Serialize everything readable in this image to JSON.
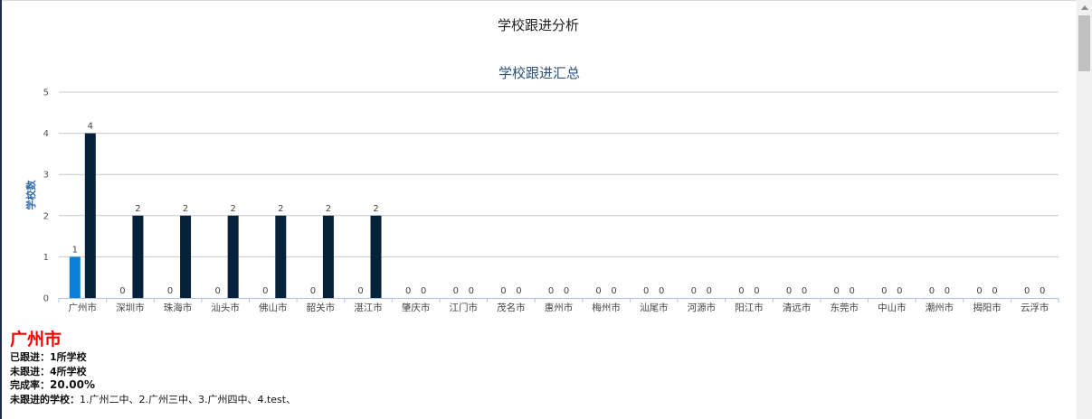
{
  "page": {
    "title": "学校跟进分析"
  },
  "chart_data": {
    "type": "bar",
    "title": "学校跟进汇总",
    "xlabel": "",
    "ylabel": "学校数",
    "ylim": [
      0,
      5
    ],
    "yticks": [
      0,
      1,
      2,
      3,
      4,
      5
    ],
    "grid": true,
    "legend": "none",
    "categories": [
      "广州市",
      "深圳市",
      "珠海市",
      "汕头市",
      "佛山市",
      "韶关市",
      "湛江市",
      "肇庆市",
      "江门市",
      "茂名市",
      "惠州市",
      "梅州市",
      "汕尾市",
      "河源市",
      "阳江市",
      "清远市",
      "东莞市",
      "中山市",
      "潮州市",
      "揭阳市",
      "云浮市"
    ],
    "series": [
      {
        "color": "#0e7fd6",
        "values": [
          1,
          0,
          0,
          0,
          0,
          0,
          0,
          0,
          0,
          0,
          0,
          0,
          0,
          0,
          0,
          0,
          0,
          0,
          0,
          0,
          0
        ]
      },
      {
        "color": "#06223a",
        "values": [
          4,
          2,
          2,
          2,
          2,
          2,
          2,
          0,
          0,
          0,
          0,
          0,
          0,
          0,
          0,
          0,
          0,
          0,
          0,
          0,
          0
        ]
      }
    ]
  },
  "detail": {
    "city": "广州市",
    "followed_label": "已跟进：",
    "followed_value": "1所学校",
    "unfollowed_label": "未跟进：",
    "unfollowed_value": "4所学校",
    "rate_label": "完成率：",
    "rate_value": "20.00%",
    "schools_label": "未跟进的学校：",
    "schools_value": "1.广州二中、2.广州三中、3.广州四中、4.test、"
  }
}
